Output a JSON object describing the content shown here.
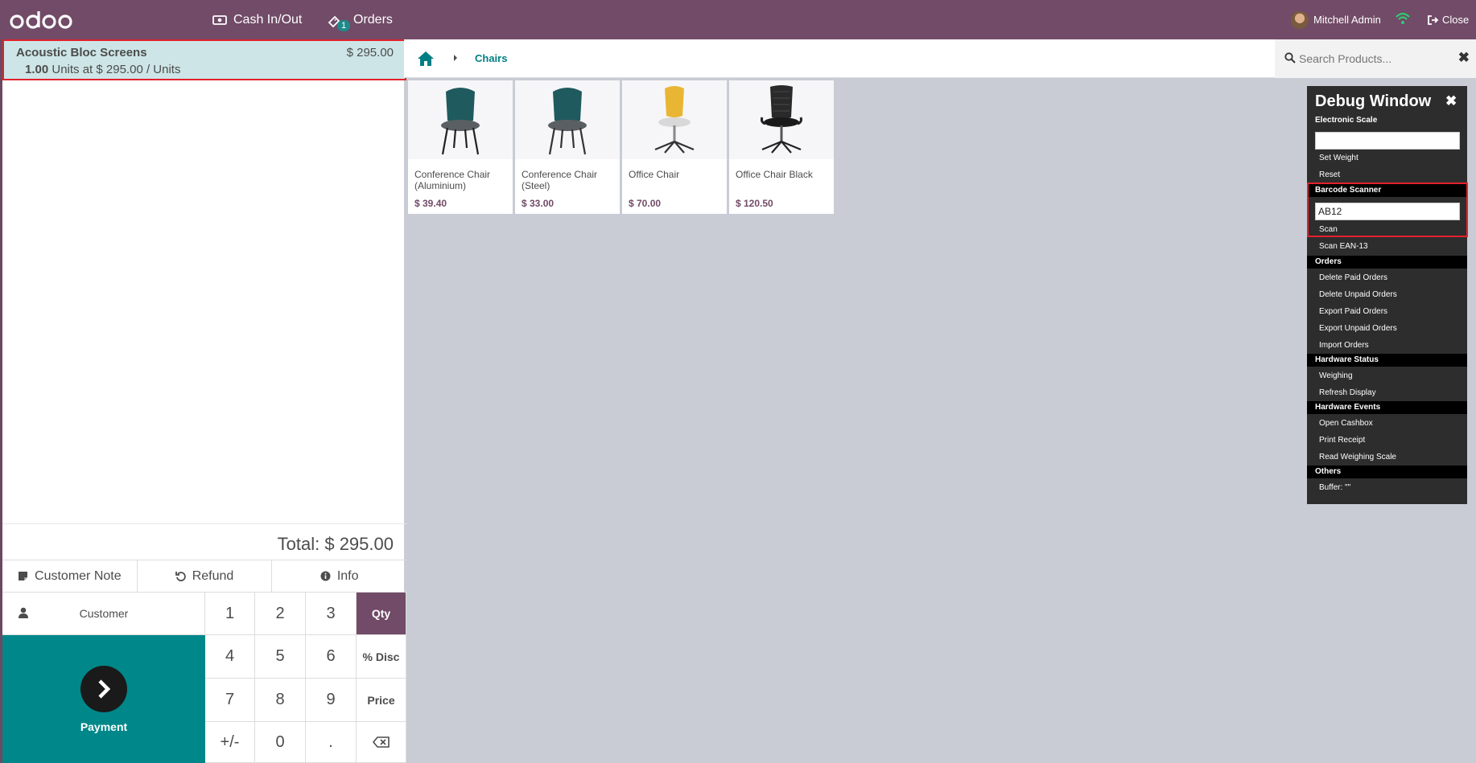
{
  "app": {
    "logo_text": "odoo"
  },
  "topbar": {
    "cash_label": "Cash In/Out",
    "orders_label": "Orders",
    "orders_badge": "1",
    "user_name": "Mitchell Admin",
    "close_label": "Close"
  },
  "order": {
    "line": {
      "product": "Acoustic Bloc Screens",
      "price": "$ 295.00",
      "qty": "1.00",
      "detail": "Units at $ 295.00 / Units"
    },
    "total": "Total: $ 295.00"
  },
  "actions": {
    "customer_note": "Customer Note",
    "refund": "Refund",
    "info": "Info"
  },
  "pad": {
    "customer": "Customer",
    "payment": "Payment",
    "keys": [
      "1",
      "2",
      "3",
      "Qty",
      "4",
      "5",
      "6",
      "% Disc",
      "7",
      "8",
      "9",
      "Price",
      "+/-",
      "0",
      "."
    ],
    "active_mode": "Qty"
  },
  "breadcrumb": {
    "category": "Chairs"
  },
  "search": {
    "placeholder": "Search Products..."
  },
  "products": [
    {
      "name": "Conference Chair (Aluminium)",
      "price": "$ 39.40",
      "color": "#1f5a5e"
    },
    {
      "name": "Conference Chair (Steel)",
      "price": "$ 33.00",
      "color": "#1f5a5e"
    },
    {
      "name": "Office Chair",
      "price": "$ 70.00",
      "color": "#e9b634"
    },
    {
      "name": "Office Chair Black",
      "price": "$ 120.50",
      "color": "#222222"
    }
  ],
  "debug": {
    "title": "Debug Window",
    "electronic_scale": "Electronic Scale",
    "scale_value": "",
    "set_weight": "Set Weight",
    "reset": "Reset",
    "barcode_scanner": "Barcode Scanner",
    "barcode_value": "AB12",
    "scan": "Scan",
    "scan_ean": "Scan EAN-13",
    "orders": "Orders",
    "delete_paid": "Delete Paid Orders",
    "delete_unpaid": "Delete Unpaid Orders",
    "export_paid": "Export Paid Orders",
    "export_unpaid": "Export Unpaid Orders",
    "import_orders": "Import Orders",
    "hardware_status": "Hardware Status",
    "weighing": "Weighing",
    "refresh_display": "Refresh Display",
    "hardware_events": "Hardware Events",
    "open_cashbox": "Open Cashbox",
    "print_receipt": "Print Receipt",
    "read_scale": "Read Weighing Scale",
    "others": "Others",
    "buffer": "Buffer: \"\""
  },
  "colors": {
    "brand": "#714b67",
    "teal": "#00878a",
    "selected_line": "#cde5e6",
    "highlight_border": "#e3212b"
  }
}
